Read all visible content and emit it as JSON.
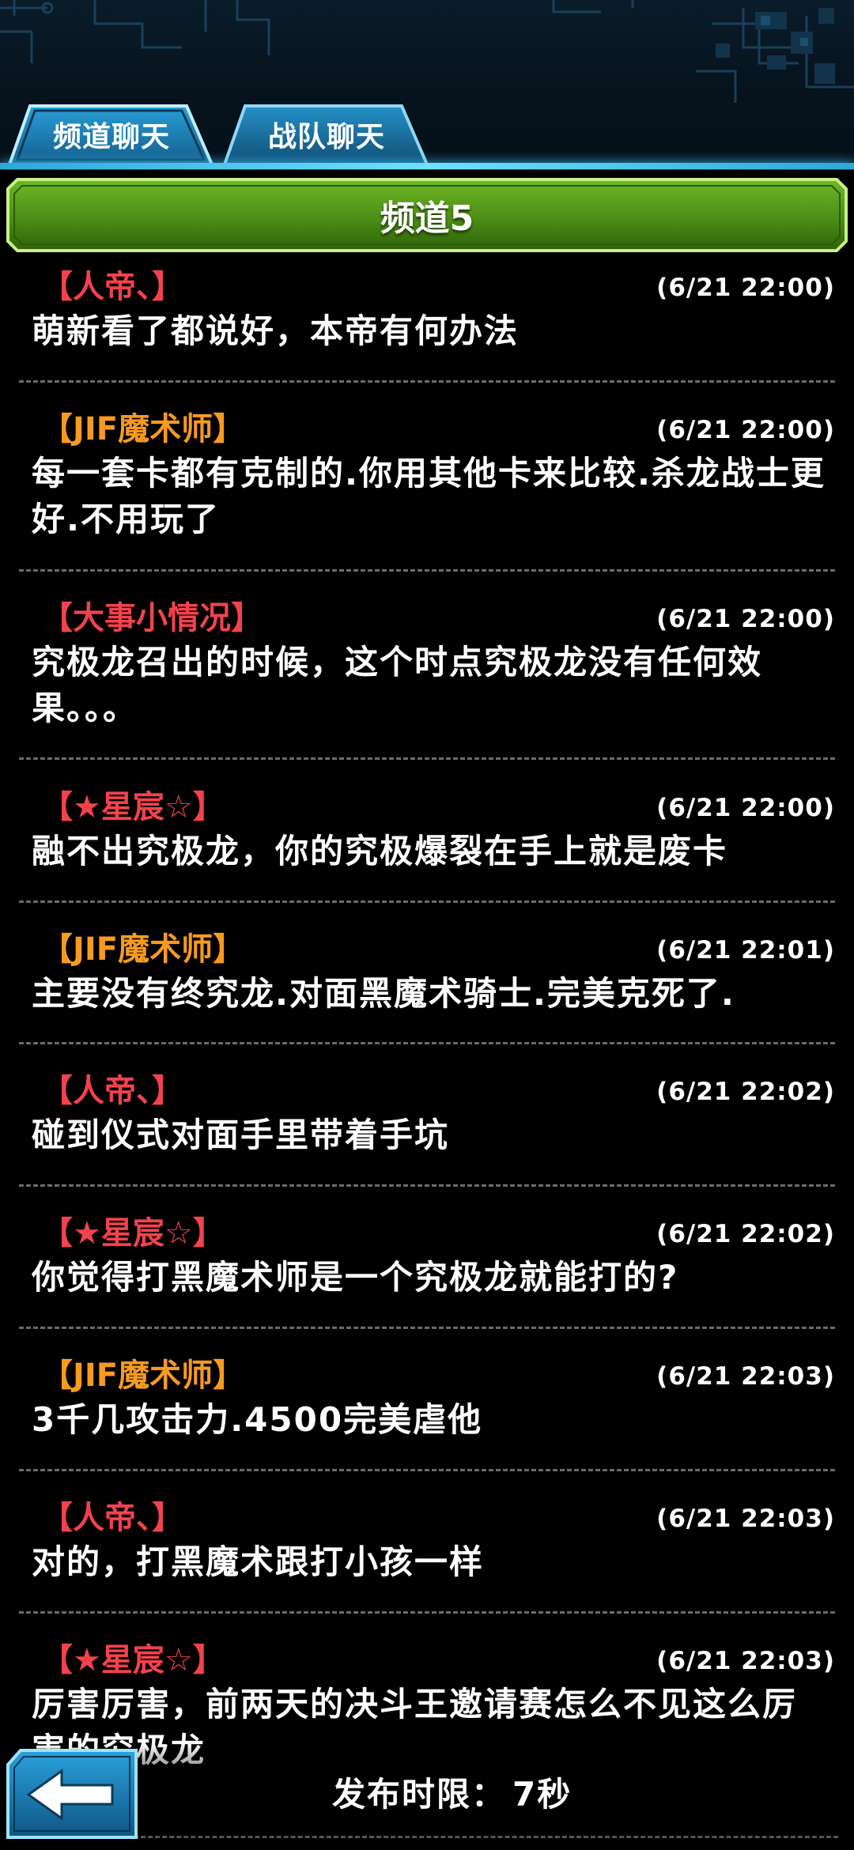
{
  "tabs": [
    {
      "label": "频道聊天",
      "active": true
    },
    {
      "label": "战队聊天",
      "active": false
    }
  ],
  "channel": {
    "title": "频道5"
  },
  "colors": {
    "name_red": "#f2424d",
    "name_orange": "#f79a20",
    "banner_green": "#5fa51d",
    "tab_blue": "#1b7fb5"
  },
  "messages": [
    {
      "name": "【人帝、】",
      "time": "(6/21 22:00)",
      "text": "萌新看了都说好，本帝有何办法",
      "name_color": "red"
    },
    {
      "name": "【JIF魔术师】",
      "time": "(6/21 22:00)",
      "text": "每一套卡都有克制的.你用其他卡来比较.杀龙战士更好.不用玩了",
      "name_color": "orange"
    },
    {
      "name": "【大事小情况】",
      "time": "(6/21 22:00)",
      "text": "究极龙召出的时候，这个时点究极龙没有任何效果。。。",
      "name_color": "red"
    },
    {
      "name": "【★星宸☆】",
      "time": "(6/21 22:00)",
      "text": "融不出究极龙，你的究极爆裂在手上就是废卡",
      "name_color": "red"
    },
    {
      "name": "【JIF魔术师】",
      "time": "(6/21 22:01)",
      "text": "主要没有终究龙.对面黑魔术骑士.完美克死了.",
      "name_color": "orange"
    },
    {
      "name": "【人帝、】",
      "time": "(6/21 22:02)",
      "text": "碰到仪式对面手里带着手坑",
      "name_color": "red"
    },
    {
      "name": "【★星宸☆】",
      "time": "(6/21 22:02)",
      "text": "你觉得打黑魔术师是一个究极龙就能打的?",
      "name_color": "red"
    },
    {
      "name": "【JIF魔术师】",
      "time": "(6/21 22:03)",
      "text": "3千几攻击力.4500完美虐他",
      "name_color": "orange"
    },
    {
      "name": "【人帝、】",
      "time": "(6/21 22:03)",
      "text": "对的，打黑魔术跟打小孩一样",
      "name_color": "red"
    },
    {
      "name": "【★星宸☆】",
      "time": "(6/21 22:03)",
      "text": "厉害厉害，前两天的决斗王邀请赛怎么不见这么厉害的究极龙",
      "name_color": "red"
    }
  ],
  "footer": {
    "cooldown_label": "发布时限：",
    "cooldown_value": "7秒",
    "back_icon": "back-arrow-icon"
  }
}
